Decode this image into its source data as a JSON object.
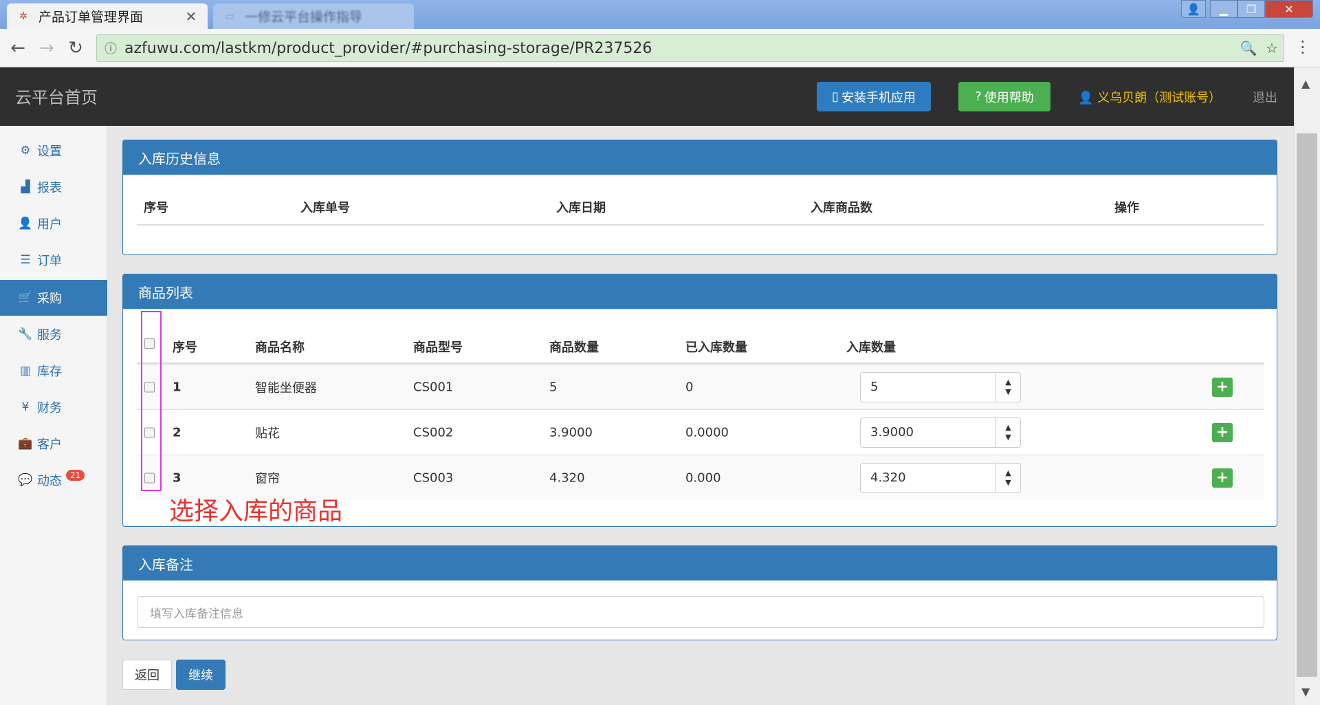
{
  "browser": {
    "tabs": [
      {
        "title": "产品订单管理界面",
        "active": true
      },
      {
        "title": "一修云平台操作指导",
        "active": false
      }
    ],
    "url": "azfuwu.com/lastkm/product_provider/#purchasing-storage/PR237526"
  },
  "header": {
    "brand": "云平台首页",
    "install_label": "安装手机应用",
    "help_label": "使用帮助",
    "user_label": "义乌贝朗（测试账号）",
    "logout_label": "退出"
  },
  "sidebar": {
    "items": [
      {
        "label": "设置",
        "icon": "gear-icon"
      },
      {
        "label": "报表",
        "icon": "bar-chart-icon"
      },
      {
        "label": "用户",
        "icon": "user-icon"
      },
      {
        "label": "订单",
        "icon": "list-icon"
      },
      {
        "label": "采购",
        "icon": "cart-icon",
        "active": true
      },
      {
        "label": "服务",
        "icon": "wrench-icon"
      },
      {
        "label": "库存",
        "icon": "barcode-icon"
      },
      {
        "label": "财务",
        "icon": "yen-icon"
      },
      {
        "label": "客户",
        "icon": "briefcase-icon"
      },
      {
        "label": "动态",
        "icon": "comment-icon",
        "badge": "21"
      }
    ]
  },
  "history_panel": {
    "title": "入库历史信息",
    "columns": [
      "序号",
      "入库单号",
      "入库日期",
      "入库商品数",
      "操作"
    ]
  },
  "product_panel": {
    "title": "商品列表",
    "columns": [
      "序号",
      "商品名称",
      "商品型号",
      "商品数量",
      "已入库数量",
      "入库数量"
    ],
    "rows": [
      {
        "index": "1",
        "name": "智能坐便器",
        "model": "CS001",
        "quantity": "5",
        "stored": "0",
        "input": "5"
      },
      {
        "index": "2",
        "name": "贴花",
        "model": "CS002",
        "quantity": "3.9000",
        "stored": "0.0000",
        "input": "3.9000"
      },
      {
        "index": "3",
        "name": "窗帘",
        "model": "CS003",
        "quantity": "4.320",
        "stored": "0.000",
        "input": "4.320"
      }
    ]
  },
  "annotation": "选择入库的商品",
  "remark_panel": {
    "title": "入库备注",
    "placeholder": "填写入库备注信息"
  },
  "actions": {
    "back_label": "返回",
    "next_label": "继续"
  },
  "colors": {
    "primary": "#337ab7",
    "success": "#4caf50",
    "header_bg": "#2f2f2f",
    "annotation_box": "#d63cd6",
    "annotation_text": "#e8332f"
  }
}
